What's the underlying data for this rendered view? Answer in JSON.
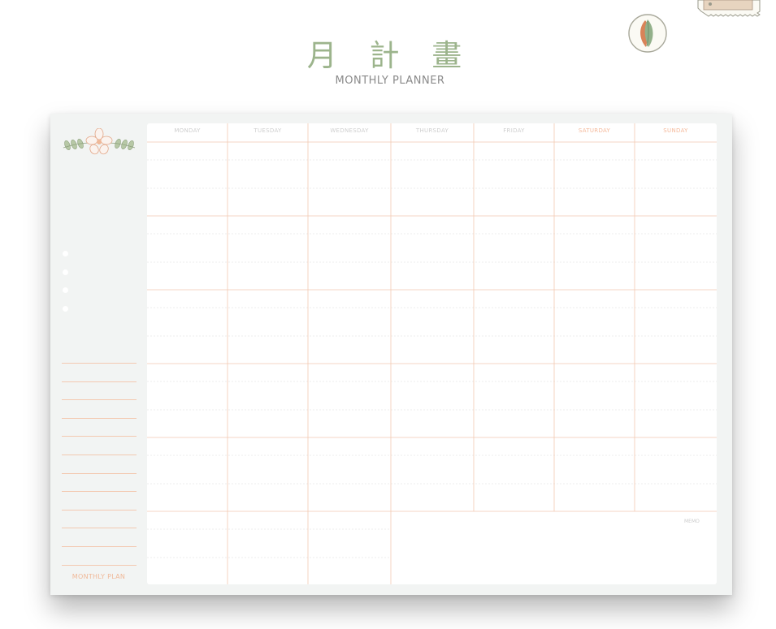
{
  "title": {
    "main": "月 計 畫",
    "sub": "MONTHLY PLANNER"
  },
  "planner": {
    "weekdays": [
      "MONDAY",
      "TUESDAY",
      "WEDNESDAY",
      "THURSDAY",
      "FRIDAY",
      "SATURDAY",
      "SUNDAY"
    ],
    "weekend_days": [
      "SATURDAY",
      "SUNDAY"
    ],
    "weeks": 5,
    "sidebar_footer": "MONTHLY PLAN",
    "memo_label": "MEMO",
    "bullet_count": 4,
    "sidebar_line_count": 12
  },
  "colors": {
    "title_green": "#9cb48c",
    "sheet_bg": "#f2f4f3",
    "grid_line": "#f3c9b1",
    "weekend_text": "#f5b99b"
  },
  "icons": [
    "leaf-badge-icon",
    "stamp-icon",
    "flower-sprig-icon"
  ]
}
